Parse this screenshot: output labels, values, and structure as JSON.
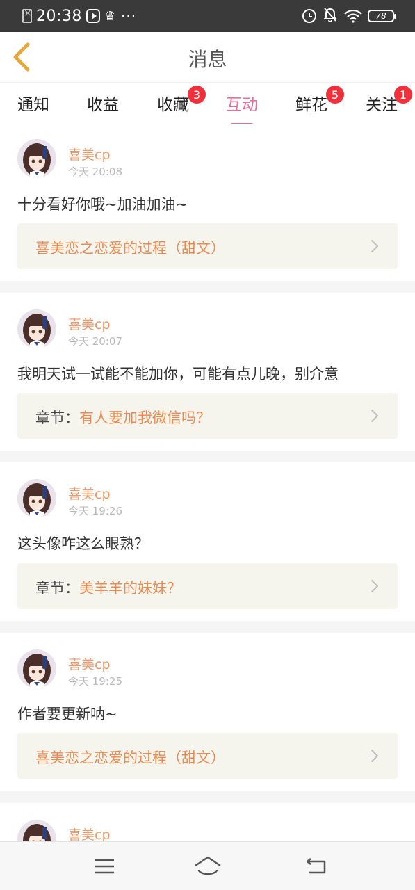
{
  "status_bar": {
    "time": "20:38",
    "battery": "78",
    "left_icons": [
      "sim-off-icon",
      "video-icon",
      "crown-icon",
      "more-dots-icon"
    ],
    "right_icons": [
      "alarm-icon",
      "bell-muted-icon",
      "wifi-icon",
      "battery-icon"
    ]
  },
  "header": {
    "title": "消息",
    "back_icon": "chevron-left-icon",
    "back_color": "#e6a73c"
  },
  "tabs": [
    {
      "label": "通知",
      "badge": ""
    },
    {
      "label": "收益",
      "badge": ""
    },
    {
      "label": "收藏",
      "badge": "3"
    },
    {
      "label": "互动",
      "badge": "",
      "active": true
    },
    {
      "label": "鲜花",
      "badge": "5"
    },
    {
      "label": "关注",
      "badge": "1"
    }
  ],
  "messages": [
    {
      "user": "喜美cp",
      "time": "今天 20:08",
      "text": "十分看好你哦~加油加油~",
      "ref_prefix": "",
      "ref_title": "喜美恋之恋爱的过程（甜文）"
    },
    {
      "user": "喜美cp",
      "time": "今天 20:07",
      "text": "我明天试一试能不能加你，可能有点儿晚，别介意",
      "ref_prefix": "章节：",
      "ref_title": "有人要加我微信吗？"
    },
    {
      "user": "喜美cp",
      "time": "今天 19:26",
      "text": "这头像咋这么眼熟？",
      "ref_prefix": "章节：",
      "ref_title": "美羊羊的妹妹？"
    },
    {
      "user": "喜美cp",
      "time": "今天 19:25",
      "text": "作者要更新呐~",
      "ref_prefix": "",
      "ref_title": "喜美恋之恋爱的过程（甜文）"
    },
    {
      "user": "喜美cp"
    }
  ],
  "colors": {
    "accent": "#e76f9c",
    "username": "#ea9a6a",
    "ref_link": "#ea8c52",
    "badge": "#f0313b",
    "ref_bg": "#f5f5ee"
  },
  "navbar": {
    "icons": [
      "menu-icon",
      "home-icon",
      "back-icon"
    ]
  }
}
